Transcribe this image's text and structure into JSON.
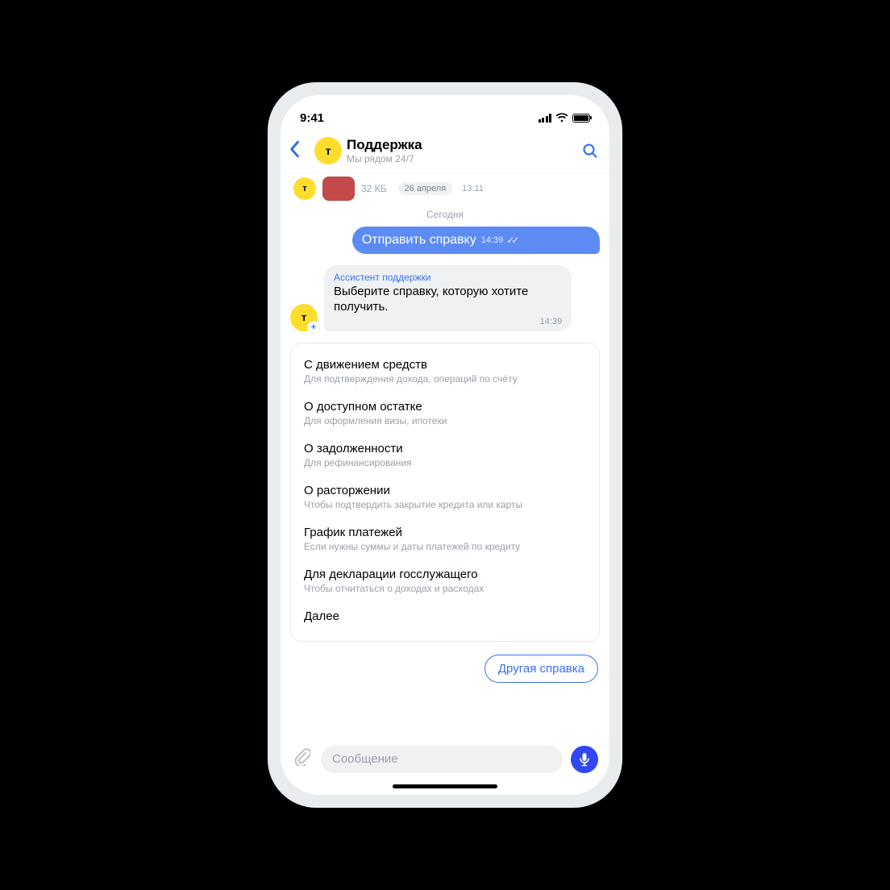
{
  "status": {
    "time": "9:41"
  },
  "header": {
    "title": "Поддержка",
    "subtitle": "Мы рядом 24/7"
  },
  "avatar_letter": "т",
  "file": {
    "size": "32 КБ",
    "date_pill": "26 апреля",
    "time": "13:11"
  },
  "day_label": "Сегодня",
  "out_msg": {
    "text": "Отправить справку",
    "time": "14:39"
  },
  "in_msg": {
    "assistant_label": "Ассистент поддержки",
    "text": "Выберите справку, которую хотите получить.",
    "time": "14:39"
  },
  "options": [
    {
      "title": "С движением средств",
      "sub": "Для подтверждения дохода, операций по счёту"
    },
    {
      "title": "О доступном остатке",
      "sub": "Для оформления визы, ипотеки"
    },
    {
      "title": "О задолженности",
      "sub": "Для рефинансирования"
    },
    {
      "title": "О расторжении",
      "sub": "Чтобы подтвердить закрытие кредита или карты"
    },
    {
      "title": "График платежей",
      "sub": "Если нужны суммы и даты платежей по кредиту"
    },
    {
      "title": "Для декларации госслужащего",
      "sub": "Чтобы отчитаться о доходах и расходах"
    }
  ],
  "more_label": "Далее",
  "chip": "Другая справка",
  "input_placeholder": "Сообщение"
}
